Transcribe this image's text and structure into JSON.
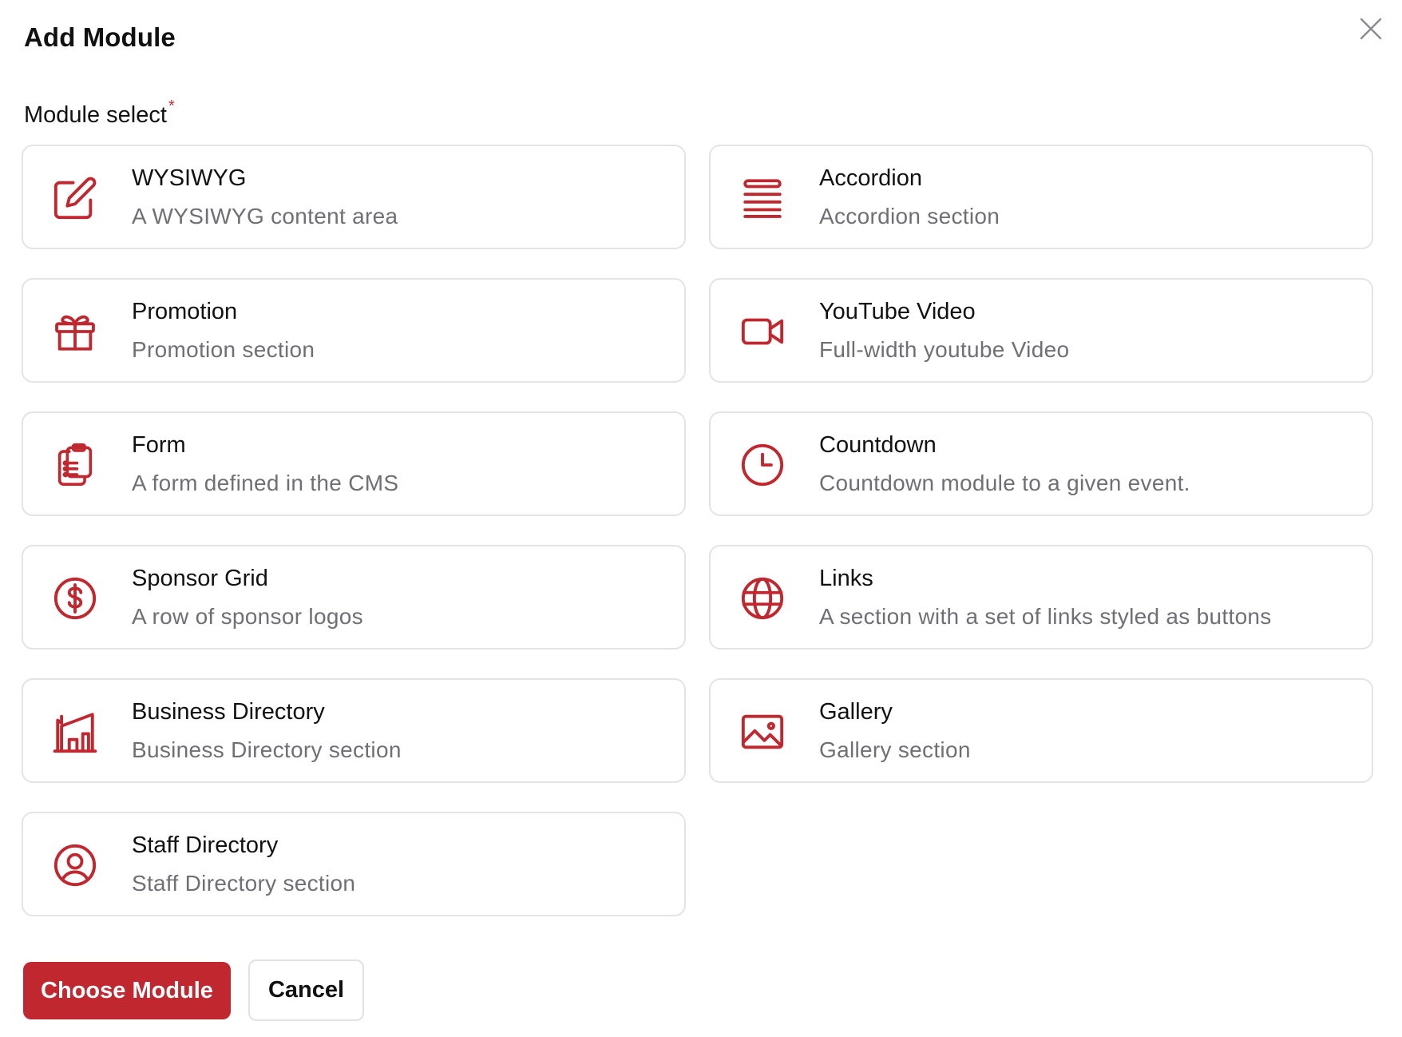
{
  "dialog": {
    "title": "Add Module",
    "close_icon": "close-icon"
  },
  "field": {
    "label": "Module select",
    "required_mark": "*"
  },
  "accent_color": "#c0272f",
  "modules": [
    {
      "name": "WYSIWYG",
      "description": "A WYSIWYG content area",
      "icon": "edit-icon"
    },
    {
      "name": "Accordion",
      "description": "Accordion section",
      "icon": "accordion-lines-icon"
    },
    {
      "name": "Promotion",
      "description": "Promotion section",
      "icon": "gift-icon"
    },
    {
      "name": "YouTube Video",
      "description": "Full-width youtube Video",
      "icon": "video-camera-icon"
    },
    {
      "name": "Form",
      "description": "A form defined in the CMS",
      "icon": "clipboard-list-icon"
    },
    {
      "name": "Countdown",
      "description": "Countdown module to a given event.",
      "icon": "clock-icon"
    },
    {
      "name": "Sponsor Grid",
      "description": "A row of sponsor logos",
      "icon": "dollar-circle-icon"
    },
    {
      "name": "Links",
      "description": "A section with a set of links styled as buttons",
      "icon": "globe-icon"
    },
    {
      "name": "Business Directory",
      "description": "Business Directory section",
      "icon": "building-icon"
    },
    {
      "name": "Gallery",
      "description": "Gallery section",
      "icon": "image-icon"
    },
    {
      "name": "Staff Directory",
      "description": "Staff Directory section",
      "icon": "user-circle-icon"
    }
  ],
  "actions": {
    "primary_label": "Choose Module",
    "secondary_label": "Cancel"
  }
}
